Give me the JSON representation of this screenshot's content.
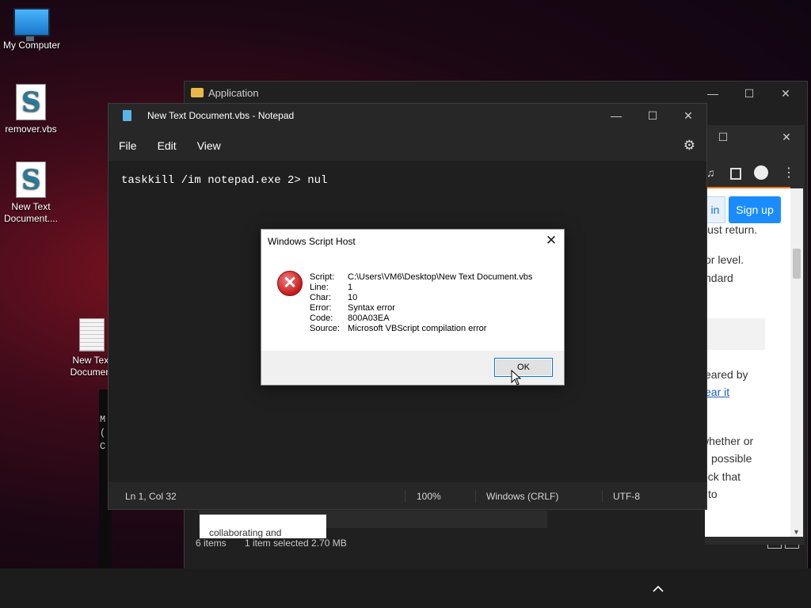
{
  "desktop": {
    "icons": [
      {
        "label": "My Computer"
      },
      {
        "label": "remover.vbs"
      },
      {
        "label": "New Text Document...."
      },
      {
        "label": "New Text Document"
      }
    ]
  },
  "explorer": {
    "title": "Application",
    "status_items": "6 items",
    "status_selected": "1 item selected  2.70 MB"
  },
  "browser": {
    "signin_label": "in",
    "signup_label": "Sign up",
    "text_lines": [
      "just return.",
      "or level.",
      "ndard",
      "eared by",
      "ear it",
      "whether or",
      "possible",
      "eck that",
      "to"
    ],
    "bottom_text": "collaborating and"
  },
  "terminal": {
    "lines": [
      "M",
      "(",
      "C"
    ]
  },
  "notepad": {
    "title": "New Text Document.vbs - Notepad",
    "menu": {
      "file": "File",
      "edit": "Edit",
      "view": "View"
    },
    "content": "taskkill /im notepad.exe 2> nul",
    "status": {
      "position": "Ln 1, Col 32",
      "zoom": "100%",
      "line_ending": "Windows (CRLF)",
      "encoding": "UTF-8"
    }
  },
  "dialog": {
    "title": "Windows Script Host",
    "close": "✕",
    "fields": [
      {
        "key": "Script:",
        "value": "C:\\Users\\VM6\\Desktop\\New Text Document.vbs"
      },
      {
        "key": "Line:",
        "value": "1"
      },
      {
        "key": "Char:",
        "value": "10"
      },
      {
        "key": "Error:",
        "value": "Syntax error"
      },
      {
        "key": "Code:",
        "value": "800A03EA"
      },
      {
        "key": "Source:",
        "value": "Microsoft VBScript compilation error"
      }
    ],
    "ok_label": "OK"
  },
  "window_controls": {
    "minimize": "—",
    "maximize": "☐",
    "close": "✕"
  },
  "taskbar": {
    "tray_chevron": "^"
  },
  "icons": {
    "error": "error-x-icon",
    "settings": "gear-icon"
  },
  "colors": {
    "accent": "#0078d7",
    "signup_button": "#1a8cff",
    "error_red": "#c5191b"
  }
}
